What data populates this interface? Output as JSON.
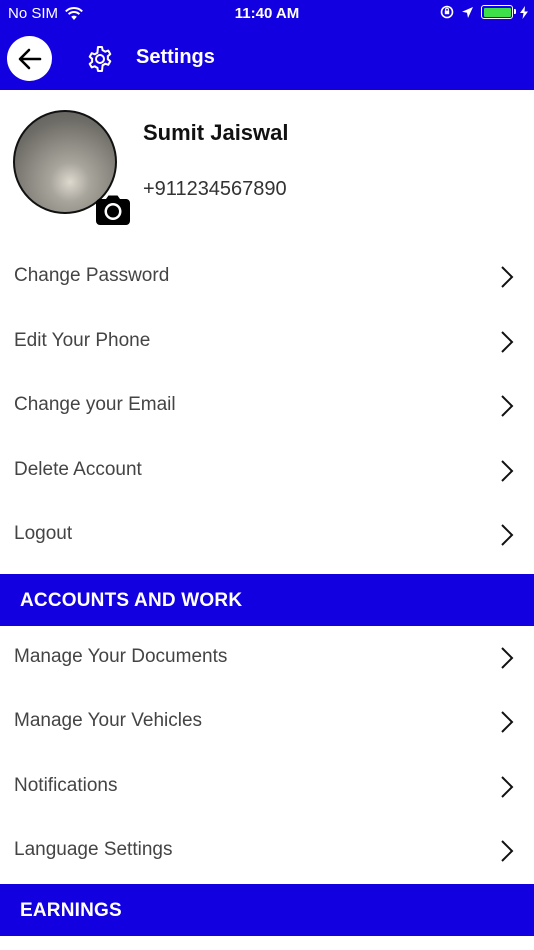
{
  "status_bar": {
    "carrier": "No SIM",
    "time": "11:40 AM"
  },
  "header": {
    "title": "Settings"
  },
  "profile": {
    "name": "Sumit Jaiswal",
    "phone": "+911234567890"
  },
  "account_items": [
    {
      "label": "Change Password"
    },
    {
      "label": "Edit Your Phone"
    },
    {
      "label": "Change your Email"
    },
    {
      "label": "Delete Account"
    },
    {
      "label": "Logout"
    }
  ],
  "sections": {
    "accounts_and_work": "ACCOUNTS AND WORK",
    "earnings": "EARNINGS"
  },
  "work_items": [
    {
      "label": "Manage Your Documents"
    },
    {
      "label": "Manage Your Vehicles"
    },
    {
      "label": "Notifications"
    },
    {
      "label": "Language Settings"
    }
  ],
  "colors": {
    "brand": "#1200e0",
    "battery": "#3ee04a"
  }
}
